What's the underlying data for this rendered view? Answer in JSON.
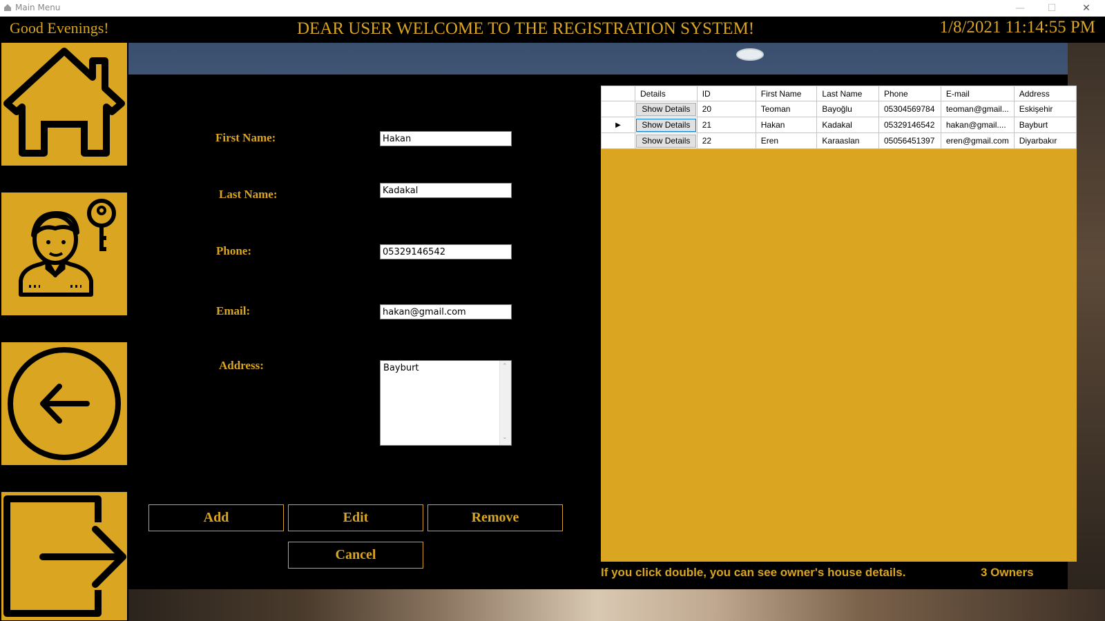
{
  "window": {
    "title": "Main Menu",
    "minimize": "—",
    "maximize": "☐",
    "close": "✕"
  },
  "header": {
    "greeting": "Good Evenings!",
    "welcome": "DEAR USER WELCOME TO THE REGISTRATION SYSTEM!",
    "datetime": "1/8/2021 11:14:55 PM"
  },
  "sidebar": {
    "items": [
      {
        "name": "home",
        "icon": "home-icon"
      },
      {
        "name": "user",
        "icon": "user-key-icon"
      },
      {
        "name": "back",
        "icon": "back-arrow-icon"
      },
      {
        "name": "exit",
        "icon": "exit-icon"
      }
    ]
  },
  "form": {
    "first_name_label": "First Name:",
    "first_name_value": "Hakan",
    "last_name_label": "Last Name:",
    "last_name_value": "Kadakal",
    "phone_label": "Phone:",
    "phone_value": "05329146542",
    "email_label": "Email:",
    "email_value": "hakan@gmail.com",
    "address_label": "Address:",
    "address_value": "Bayburt"
  },
  "buttons": {
    "add": "Add",
    "edit": "Edit",
    "remove": "Remove",
    "cancel": "Cancel"
  },
  "grid": {
    "columns": [
      "",
      "Details",
      "ID",
      "First Name",
      "Last Name",
      "Phone",
      "E-mail",
      "Address"
    ],
    "rows": [
      {
        "selected": false,
        "details": "Show Details",
        "id": "20",
        "first_name": "Teoman",
        "last_name": "Bayoğlu",
        "phone": "05304569784",
        "email": "teoman@gmail...",
        "address": "Eskişehir"
      },
      {
        "selected": true,
        "details": "Show Details",
        "id": "21",
        "first_name": "Hakan",
        "last_name": "Kadakal",
        "phone": "05329146542",
        "email": "hakan@gmail....",
        "address": "Bayburt"
      },
      {
        "selected": false,
        "details": "Show Details",
        "id": "22",
        "first_name": "Eren",
        "last_name": "Karaaslan",
        "phone": "05056451397",
        "email": "eren@gmail.com",
        "address": "Diyarbakır"
      }
    ],
    "selected_marker": "▶"
  },
  "footer": {
    "hint": "If you click double, you can see owner's house details.",
    "count": "3 Owners"
  },
  "colors": {
    "accent": "#DAA520",
    "background": "#000000"
  }
}
